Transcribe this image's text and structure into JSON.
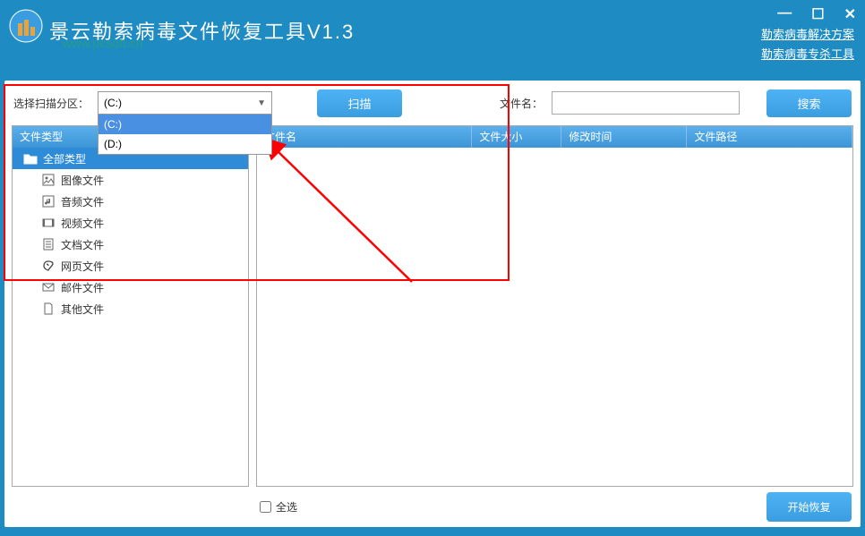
{
  "header": {
    "title": "景云勒索病毒文件恢复工具V1.3",
    "watermark": "www.pcsoft.cn",
    "link1": "勒索病毒解决方案",
    "link2": "勒索病毒专杀工具"
  },
  "controls": {
    "partition_label": "选择扫描分区：",
    "partition_selected": "(C:)",
    "partition_options": [
      "(C:)",
      "(D:)"
    ],
    "scan_btn": "扫描",
    "filename_label": "文件名：",
    "search_btn": "搜索"
  },
  "sidebar": {
    "header": "文件类型",
    "root": "全部类型",
    "items": [
      {
        "label": "图像文件",
        "icon": "image"
      },
      {
        "label": "音频文件",
        "icon": "audio"
      },
      {
        "label": "视频文件",
        "icon": "video"
      },
      {
        "label": "文档文件",
        "icon": "doc"
      },
      {
        "label": "网页文件",
        "icon": "web"
      },
      {
        "label": "邮件文件",
        "icon": "mail"
      },
      {
        "label": "其他文件",
        "icon": "file"
      }
    ]
  },
  "table": {
    "col1": "文件名",
    "col2": "文件大小",
    "col3": "修改时间",
    "col4": "文件路径"
  },
  "bottom": {
    "select_all": "全选",
    "recover_btn": "开始恢复"
  }
}
